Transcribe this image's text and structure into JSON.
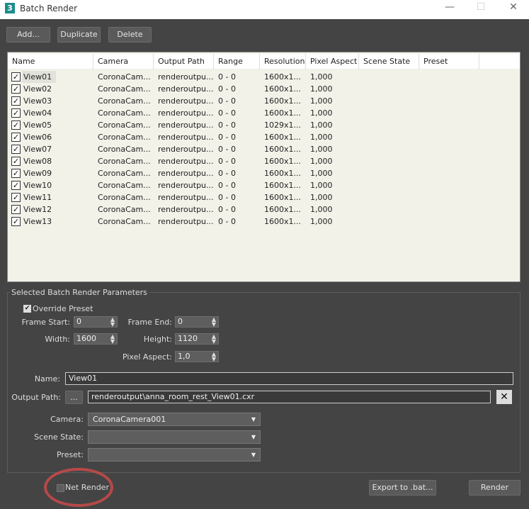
{
  "window": {
    "title": "Batch Render",
    "app_icon": "3"
  },
  "toolbar": {
    "add": "Add...",
    "duplicate": "Duplicate",
    "delete": "Delete"
  },
  "table": {
    "columns": [
      "Name",
      "Camera",
      "Output Path",
      "Range",
      "Resolution",
      "Pixel Aspect",
      "Scene State",
      "Preset"
    ],
    "rows": [
      {
        "name": "View01",
        "camera": "CoronaCam...",
        "output": "renderoutpu...",
        "range": "0 - 0",
        "resolution": "1600x1...",
        "aspect": "1,000"
      },
      {
        "name": "View02",
        "camera": "CoronaCam...",
        "output": "renderoutpu...",
        "range": "0 - 0",
        "resolution": "1600x1...",
        "aspect": "1,000"
      },
      {
        "name": "View03",
        "camera": "CoronaCam...",
        "output": "renderoutpu...",
        "range": "0 - 0",
        "resolution": "1600x1...",
        "aspect": "1,000"
      },
      {
        "name": "View04",
        "camera": "CoronaCam...",
        "output": "renderoutpu...",
        "range": "0 - 0",
        "resolution": "1600x1...",
        "aspect": "1,000"
      },
      {
        "name": "View05",
        "camera": "CoronaCam...",
        "output": "renderoutpu...",
        "range": "0 - 0",
        "resolution": "1029x1...",
        "aspect": "1,000"
      },
      {
        "name": "View06",
        "camera": "CoronaCam...",
        "output": "renderoutpu...",
        "range": "0 - 0",
        "resolution": "1600x1...",
        "aspect": "1,000"
      },
      {
        "name": "View07",
        "camera": "CoronaCam...",
        "output": "renderoutpu...",
        "range": "0 - 0",
        "resolution": "1600x1...",
        "aspect": "1,000"
      },
      {
        "name": "View08",
        "camera": "CoronaCam...",
        "output": "renderoutpu...",
        "range": "0 - 0",
        "resolution": "1600x1...",
        "aspect": "1,000"
      },
      {
        "name": "View09",
        "camera": "CoronaCam...",
        "output": "renderoutpu...",
        "range": "0 - 0",
        "resolution": "1600x1...",
        "aspect": "1,000"
      },
      {
        "name": "View10",
        "camera": "CoronaCam...",
        "output": "renderoutpu...",
        "range": "0 - 0",
        "resolution": "1600x1...",
        "aspect": "1,000"
      },
      {
        "name": "View11",
        "camera": "CoronaCam...",
        "output": "renderoutpu...",
        "range": "0 - 0",
        "resolution": "1600x1...",
        "aspect": "1,000"
      },
      {
        "name": "View12",
        "camera": "CoronaCam...",
        "output": "renderoutpu...",
        "range": "0 - 0",
        "resolution": "1600x1...",
        "aspect": "1,000"
      },
      {
        "name": "View13",
        "camera": "CoronaCam...",
        "output": "renderoutpu...",
        "range": "0 - 0",
        "resolution": "1600x1...",
        "aspect": "1,000"
      }
    ]
  },
  "params": {
    "group_title": "Selected Batch Render Parameters",
    "override_preset": "Override Preset",
    "frame_start_label": "Frame Start:",
    "frame_start": "0",
    "frame_end_label": "Frame End:",
    "frame_end": "0",
    "width_label": "Width:",
    "width": "1600",
    "height_label": "Height:",
    "height": "1120",
    "pixel_aspect_label": "Pixel Aspect:",
    "pixel_aspect": "1,0",
    "name_label": "Name:",
    "name": "View01",
    "output_label": "Output Path:",
    "browse": "...",
    "output": "renderoutput\\anna_room_rest_View01.cxr",
    "camera_label": "Camera:",
    "camera": "CoronaCamera001",
    "scene_state_label": "Scene State:",
    "preset_label": "Preset:"
  },
  "footer": {
    "net_render": "Net Render",
    "export": "Export to .bat...",
    "render": "Render"
  }
}
